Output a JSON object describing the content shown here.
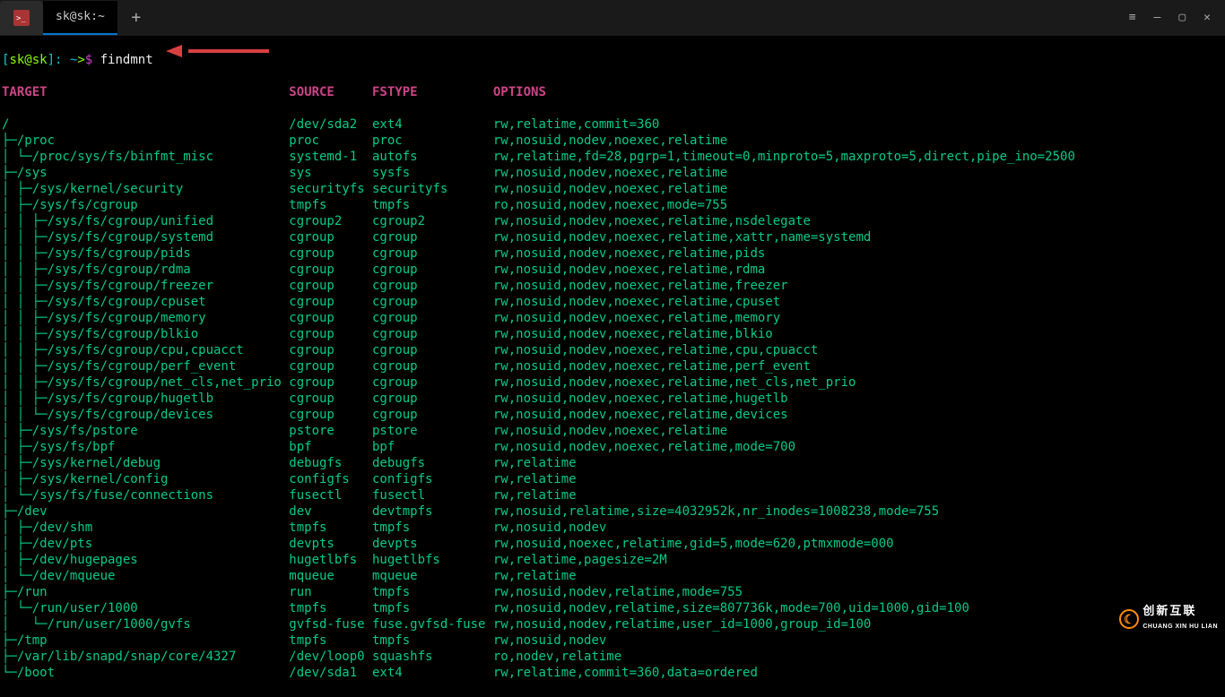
{
  "titlebar": {
    "tab_label": "sk@sk:~",
    "plus": "+",
    "menu_glyph": "≡",
    "min_glyph": "—",
    "max_glyph": "▢",
    "close_glyph": "✕"
  },
  "prompt": {
    "lbr": "[",
    "user": "sk",
    "at": "@",
    "host": "sk",
    "rbr": "]",
    "sep": ": ",
    "tilde": "~",
    "arrow": ">",
    "dollar": "$ ",
    "command": "findmnt"
  },
  "columns": {
    "target": "TARGET",
    "source": "SOURCE",
    "fstype": "FSTYPE",
    "options": "OPTIONS"
  },
  "rows": [
    {
      "i": 0,
      "t": "/",
      "s": "/dev/sda2",
      "f": "ext4",
      "o": "rw,relatime,commit=360"
    },
    {
      "i": 1,
      "t": "/proc",
      "s": "proc",
      "f": "proc",
      "o": "rw,nosuid,nodev,noexec,relatime"
    },
    {
      "i": 2,
      "t": "/proc/sys/fs/binfmt_misc",
      "s": "systemd-1",
      "f": "autofs",
      "o": "rw,relatime,fd=28,pgrp=1,timeout=0,minproto=5,maxproto=5,direct,pipe_ino=2500"
    },
    {
      "i": 1,
      "t": "/sys",
      "s": "sys",
      "f": "sysfs",
      "o": "rw,nosuid,nodev,noexec,relatime"
    },
    {
      "i": 2,
      "t": "/sys/kernel/security",
      "s": "securityfs",
      "f": "securityfs",
      "o": "rw,nosuid,nodev,noexec,relatime"
    },
    {
      "i": 2,
      "t": "/sys/fs/cgroup",
      "s": "tmpfs",
      "f": "tmpfs",
      "o": "ro,nosuid,nodev,noexec,mode=755"
    },
    {
      "i": 3,
      "t": "/sys/fs/cgroup/unified",
      "s": "cgroup2",
      "f": "cgroup2",
      "o": "rw,nosuid,nodev,noexec,relatime,nsdelegate"
    },
    {
      "i": 3,
      "t": "/sys/fs/cgroup/systemd",
      "s": "cgroup",
      "f": "cgroup",
      "o": "rw,nosuid,nodev,noexec,relatime,xattr,name=systemd"
    },
    {
      "i": 3,
      "t": "/sys/fs/cgroup/pids",
      "s": "cgroup",
      "f": "cgroup",
      "o": "rw,nosuid,nodev,noexec,relatime,pids"
    },
    {
      "i": 3,
      "t": "/sys/fs/cgroup/rdma",
      "s": "cgroup",
      "f": "cgroup",
      "o": "rw,nosuid,nodev,noexec,relatime,rdma"
    },
    {
      "i": 3,
      "t": "/sys/fs/cgroup/freezer",
      "s": "cgroup",
      "f": "cgroup",
      "o": "rw,nosuid,nodev,noexec,relatime,freezer"
    },
    {
      "i": 3,
      "t": "/sys/fs/cgroup/cpuset",
      "s": "cgroup",
      "f": "cgroup",
      "o": "rw,nosuid,nodev,noexec,relatime,cpuset"
    },
    {
      "i": 3,
      "t": "/sys/fs/cgroup/memory",
      "s": "cgroup",
      "f": "cgroup",
      "o": "rw,nosuid,nodev,noexec,relatime,memory"
    },
    {
      "i": 3,
      "t": "/sys/fs/cgroup/blkio",
      "s": "cgroup",
      "f": "cgroup",
      "o": "rw,nosuid,nodev,noexec,relatime,blkio"
    },
    {
      "i": 3,
      "t": "/sys/fs/cgroup/cpu,cpuacct",
      "s": "cgroup",
      "f": "cgroup",
      "o": "rw,nosuid,nodev,noexec,relatime,cpu,cpuacct"
    },
    {
      "i": 3,
      "t": "/sys/fs/cgroup/perf_event",
      "s": "cgroup",
      "f": "cgroup",
      "o": "rw,nosuid,nodev,noexec,relatime,perf_event"
    },
    {
      "i": 3,
      "t": "/sys/fs/cgroup/net_cls,net_prio",
      "s": "cgroup",
      "f": "cgroup",
      "o": "rw,nosuid,nodev,noexec,relatime,net_cls,net_prio"
    },
    {
      "i": 3,
      "t": "/sys/fs/cgroup/hugetlb",
      "s": "cgroup",
      "f": "cgroup",
      "o": "rw,nosuid,nodev,noexec,relatime,hugetlb"
    },
    {
      "i": 3,
      "t": "/sys/fs/cgroup/devices",
      "s": "cgroup",
      "f": "cgroup",
      "o": "rw,nosuid,nodev,noexec,relatime,devices",
      "last": true
    },
    {
      "i": 2,
      "t": "/sys/fs/pstore",
      "s": "pstore",
      "f": "pstore",
      "o": "rw,nosuid,nodev,noexec,relatime"
    },
    {
      "i": 2,
      "t": "/sys/fs/bpf",
      "s": "bpf",
      "f": "bpf",
      "o": "rw,nosuid,nodev,noexec,relatime,mode=700"
    },
    {
      "i": 2,
      "t": "/sys/kernel/debug",
      "s": "debugfs",
      "f": "debugfs",
      "o": "rw,relatime"
    },
    {
      "i": 2,
      "t": "/sys/kernel/config",
      "s": "configfs",
      "f": "configfs",
      "o": "rw,relatime"
    },
    {
      "i": 2,
      "t": "/sys/fs/fuse/connections",
      "s": "fusectl",
      "f": "fusectl",
      "o": "rw,relatime",
      "last": true
    },
    {
      "i": 1,
      "t": "/dev",
      "s": "dev",
      "f": "devtmpfs",
      "o": "rw,nosuid,relatime,size=4032952k,nr_inodes=1008238,mode=755"
    },
    {
      "i": 2,
      "t": "/dev/shm",
      "s": "tmpfs",
      "f": "tmpfs",
      "o": "rw,nosuid,nodev"
    },
    {
      "i": 2,
      "t": "/dev/pts",
      "s": "devpts",
      "f": "devpts",
      "o": "rw,nosuid,noexec,relatime,gid=5,mode=620,ptmxmode=000"
    },
    {
      "i": 2,
      "t": "/dev/hugepages",
      "s": "hugetlbfs",
      "f": "hugetlbfs",
      "o": "rw,relatime,pagesize=2M"
    },
    {
      "i": 2,
      "t": "/dev/mqueue",
      "s": "mqueue",
      "f": "mqueue",
      "o": "rw,relatime",
      "last": true
    },
    {
      "i": 1,
      "t": "/run",
      "s": "run",
      "f": "tmpfs",
      "o": "rw,nosuid,nodev,relatime,mode=755"
    },
    {
      "i": 2,
      "t": "/run/user/1000",
      "s": "tmpfs",
      "f": "tmpfs",
      "o": "rw,nosuid,nodev,relatime,size=807736k,mode=700,uid=1000,gid=100",
      "last": true
    },
    {
      "i": 3,
      "t": "/run/user/1000/gvfs",
      "s": "gvfsd-fuse",
      "f": "fuse.gvfsd-fuse",
      "o": "rw,nosuid,nodev,relatime,user_id=1000,group_id=100",
      "last": true
    },
    {
      "i": 1,
      "t": "/tmp",
      "s": "tmpfs",
      "f": "tmpfs",
      "o": "rw,nosuid,nodev"
    },
    {
      "i": 1,
      "t": "/var/lib/snapd/snap/core/4327",
      "s": "/dev/loop0",
      "f": "squashfs",
      "o": "ro,nodev,relatime"
    },
    {
      "i": 1,
      "t": "/boot",
      "s": "/dev/sda1",
      "f": "ext4",
      "o": "rw,relatime,commit=360,data=ordered"
    }
  ],
  "layout": {
    "col_source": 38,
    "col_fstype": 49,
    "col_options": 65
  },
  "watermark": {
    "top": "创新互联",
    "bottom": "CHUANG XIN HU LIAN",
    "logo": "☾"
  }
}
